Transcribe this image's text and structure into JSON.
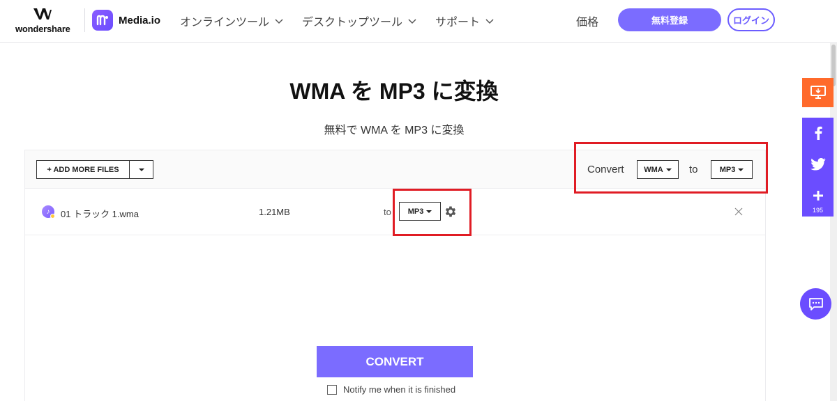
{
  "header": {
    "brand_text": "wondershare",
    "product_name": "Media.io",
    "nav": [
      {
        "label": "オンラインツール"
      },
      {
        "label": "デスクトップツール"
      },
      {
        "label": "サポート"
      }
    ],
    "price_label": "価格",
    "signup_label": "無料登録",
    "login_label": "ログイン"
  },
  "main": {
    "title": "WMA を MP3 に変換",
    "subtitle": "無料で WMA を MP3 に変換"
  },
  "toolbar": {
    "add_files_label": "+ ADD MORE FILES",
    "convert_label": "Convert",
    "from_format": "WMA",
    "to_label": "to",
    "to_format": "MP3"
  },
  "files": [
    {
      "name": "01 トラック 1.wma",
      "size": "1.21MB",
      "to_label": "to",
      "target_format": "MP3"
    }
  ],
  "actions": {
    "convert_label": "CONVERT",
    "notify_label": "Notify me when it is finished"
  },
  "sidebar": {
    "share_count": "195"
  },
  "colors": {
    "accent": "#7b6cff",
    "highlight_box": "#e01c24",
    "desktop_button": "#ff6a2b",
    "share_bar": "#6b4dff"
  }
}
